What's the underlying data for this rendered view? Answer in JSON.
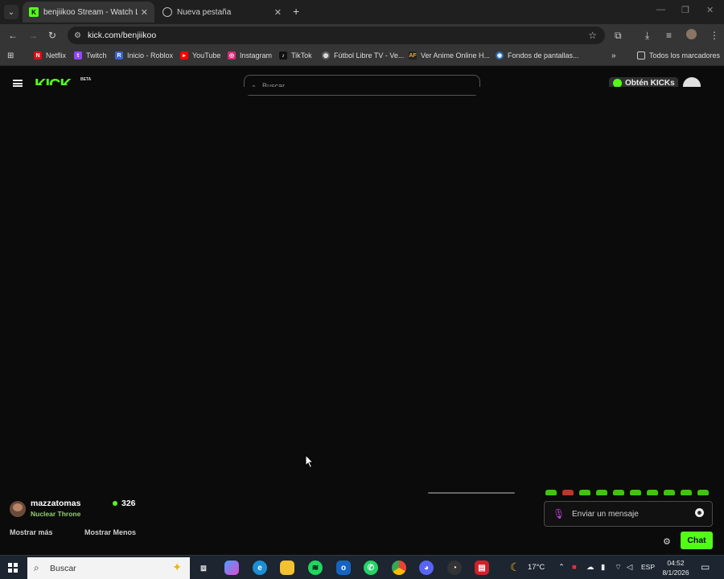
{
  "browser": {
    "tabs": [
      {
        "title": "benjiikoo Stream - Watch Live o",
        "active": true,
        "favicon": "kick-icon"
      },
      {
        "title": "Nueva pestaña",
        "active": false,
        "favicon": "chrome-icon"
      }
    ],
    "url": "kick.com/benjiikoo",
    "bookmarks": [
      {
        "label": "Netflix",
        "icon": "netflix-icon",
        "color": "#e50914"
      },
      {
        "label": "Twitch",
        "icon": "twitch-icon",
        "color": "#9146ff"
      },
      {
        "label": "Inicio - Roblox",
        "icon": "roblox-icon",
        "color": "#3b62d6"
      },
      {
        "label": "YouTube",
        "icon": "youtube-icon",
        "color": "#ff0000"
      },
      {
        "label": "Instagram",
        "icon": "instagram-icon",
        "color": "#d62976"
      },
      {
        "label": "TikTok",
        "icon": "tiktok-icon",
        "color": "#111111"
      },
      {
        "label": "Fútbol Libre TV - Ve...",
        "icon": "globe-icon",
        "color": "#666666"
      },
      {
        "label": "Ver Anime Online H...",
        "icon": "anime-icon",
        "color": "#222222"
      },
      {
        "label": "Fondos de pantallas...",
        "icon": "eye-icon",
        "color": "#2b6cb0"
      }
    ],
    "all_bookmarks": "Todos los marcadores"
  },
  "site": {
    "logo": "KICK",
    "beta": "BETA",
    "search_placeholder": "Buscar",
    "kicks_button": "Obtén KICKs"
  },
  "stream": {
    "streamer": "mazzatomas",
    "category": "Nuclear Throne",
    "viewers": "326",
    "show_more": "Mostrar más",
    "show_less": "Mostrar Menos"
  },
  "chat": {
    "placeholder": "Enviar un mensaje",
    "button": "Chat"
  },
  "taskbar": {
    "search": "Buscar",
    "weather": "17°C",
    "language": "ESP",
    "time": "04:52",
    "date": "8/1/2026"
  },
  "colors": {
    "kick_green": "#53fc18",
    "page_bg": "#0b0b0b"
  }
}
